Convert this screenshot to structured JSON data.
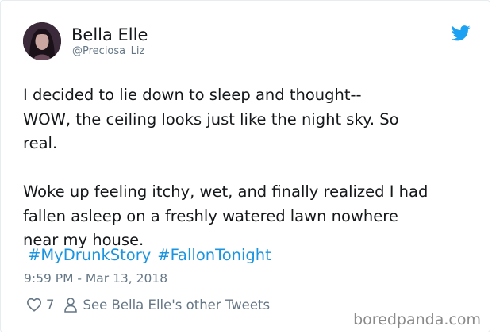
{
  "author": {
    "display_name": "Bella Elle",
    "handle": "@Preciosa_Liz"
  },
  "tweet": {
    "text": "I decided to lie down to sleep and thought--\nWOW, the ceiling looks just like the night sky. So\nreal.\n\nWoke up feeling itchy, wet, and finally realized I had\nfallen asleep on a freshly watered lawn nowhere\nnear my house.",
    "hashtags": [
      "#MyDrunkStory",
      "#FallonTonight"
    ],
    "timestamp": "9:59 PM - Mar 13, 2018",
    "like_count": "7",
    "see_tweets_label": "See Bella Elle's other Tweets"
  },
  "watermark": "boredpanda.com",
  "icons": {
    "brand": "twitter-bird-icon",
    "like": "heart-icon",
    "profile": "person-icon"
  },
  "colors": {
    "link": "#1b95e0",
    "secondary_text": "#657786",
    "brand": "#1da1f2"
  }
}
